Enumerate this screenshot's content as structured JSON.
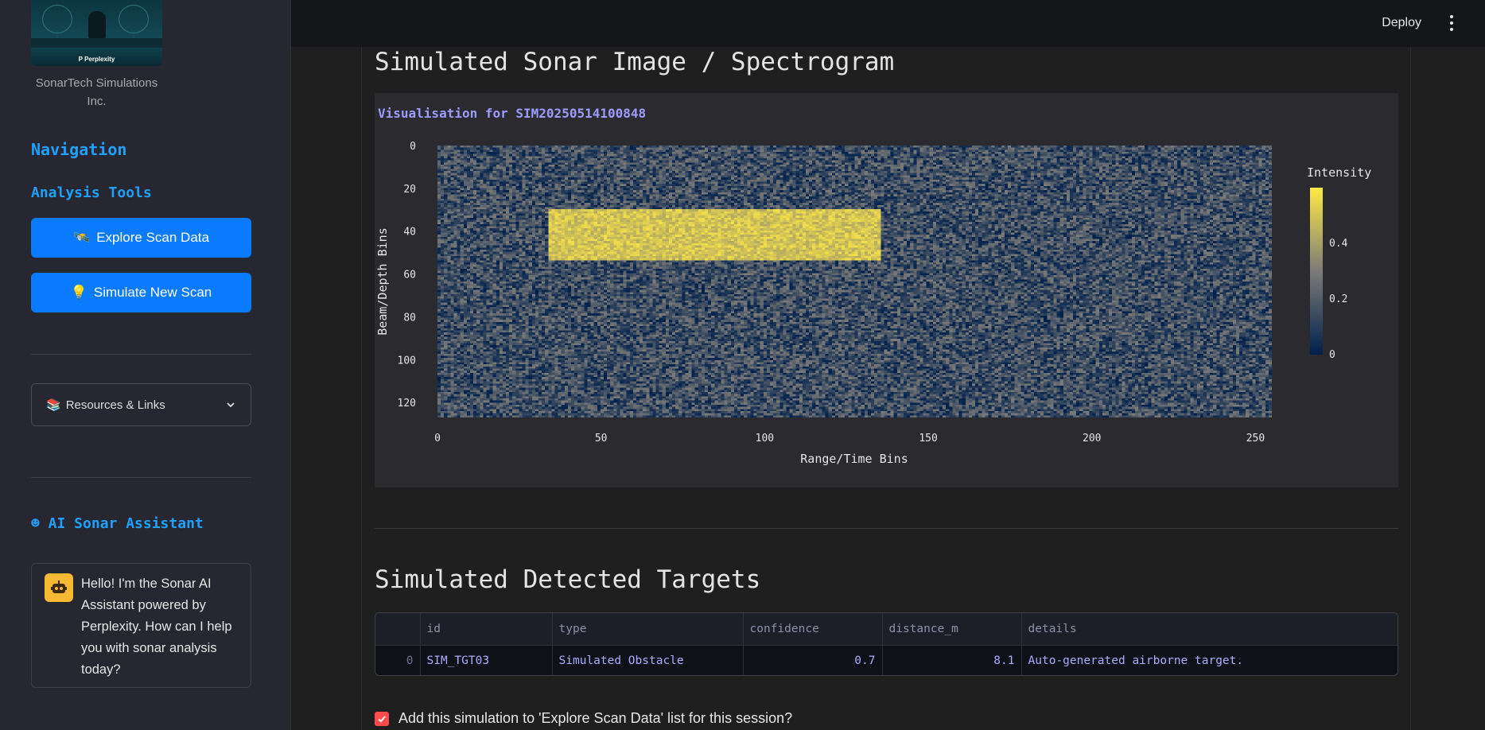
{
  "sidebar": {
    "logo_caption": "P Perplexity",
    "company": "SonarTech Simulations Inc.",
    "navigation_heading": "Navigation",
    "tools_heading": "Analysis Tools",
    "explore_button": {
      "icon": "satellite-icon",
      "glyph": "🛰️",
      "label": "Explore Scan Data"
    },
    "simulate_button": {
      "icon": "lightbulb-icon",
      "glyph": "💡",
      "label": "Simulate New Scan"
    },
    "resources_expander": {
      "icon": "books-icon",
      "glyph": "📚",
      "label": "Resources & Links"
    },
    "assistant_heading": "☻ AI Sonar Assistant",
    "assistant_message": "Hello! I'm the Sonar AI Assistant powered by Perplexity. How can I help you with sonar analysis today?"
  },
  "topbar": {
    "deploy_label": "Deploy"
  },
  "main": {
    "section1_title": "Simulated Sonar Image / Spectrogram",
    "section2_title": "Simulated Detected Targets",
    "checkbox_label": "Add this simulation to 'Explore Scan Data' list for this session?",
    "checkbox_checked": true
  },
  "chart_data": {
    "type": "heatmap",
    "title": "Visualisation for SIM20250514100848",
    "xlabel": "Range/Time Bins",
    "ylabel": "Beam/Depth Bins",
    "x_ticks": [
      0,
      50,
      100,
      150,
      200,
      250
    ],
    "y_ticks": [
      0,
      20,
      40,
      60,
      80,
      100,
      120
    ],
    "xlim": [
      0,
      255
    ],
    "ylim": [
      0,
      127
    ],
    "colorbar": {
      "title": "Intensity",
      "ticks": [
        0,
        0.2,
        0.4
      ],
      "range": [
        0,
        0.6
      ],
      "colorscale": [
        "#00204c",
        "#7c7b78",
        "#ffe945"
      ]
    },
    "target_region": {
      "x_range": [
        34,
        135
      ],
      "y_range": [
        30,
        53
      ],
      "intensity": 0.5
    },
    "background_noise": {
      "min": 0.0,
      "max": 0.3
    }
  },
  "targets_table": {
    "columns": [
      "",
      "id",
      "type",
      "confidence",
      "distance_m",
      "details"
    ],
    "rows": [
      [
        "0",
        "SIM_TGT03",
        "Simulated Obstacle",
        "0.7",
        "8.1",
        "Auto-generated airborne target."
      ]
    ]
  },
  "colors": {
    "accent": "#1fa2ff",
    "button": "#0a7bff",
    "checkbox": "#ff4b4b",
    "title_accent": "#9c9dff"
  }
}
